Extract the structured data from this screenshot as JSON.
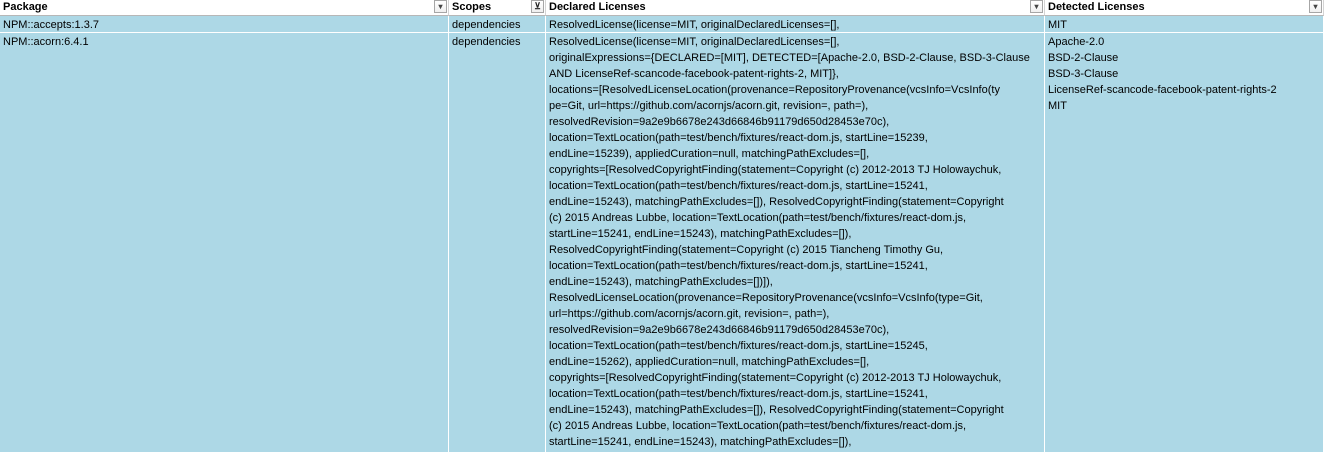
{
  "headers": {
    "package": "Package",
    "scopes": "Scopes",
    "declared": "Declared Licenses",
    "detected": "Detected Licenses"
  },
  "rows": [
    {
      "package": "NPM::accepts:1.3.7",
      "scopes": "dependencies",
      "declared": "ResolvedLicense(license=MIT, originalDeclaredLicenses=[],",
      "detected": "MIT"
    },
    {
      "package": "NPM::acorn:6.4.1",
      "scopes": "dependencies",
      "declared": "ResolvedLicense(license=MIT, originalDeclaredLicenses=[],\noriginalExpressions={DECLARED=[MIT], DETECTED=[Apache-2.0, BSD-2-Clause, BSD-3-Clause\nAND LicenseRef-scancode-facebook-patent-rights-2, MIT]},\nlocations=[ResolvedLicenseLocation(provenance=RepositoryProvenance(vcsInfo=VcsInfo(ty\npe=Git, url=https://github.com/acornjs/acorn.git, revision=, path=),\nresolvedRevision=9a2e9b6678e243d66846b91179d650d28453e70c),\nlocation=TextLocation(path=test/bench/fixtures/react-dom.js, startLine=15239,\nendLine=15239), appliedCuration=null, matchingPathExcludes=[],\ncopyrights=[ResolvedCopyrightFinding(statement=Copyright (c) 2012-2013 TJ Holowaychuk,\nlocation=TextLocation(path=test/bench/fixtures/react-dom.js, startLine=15241,\nendLine=15243), matchingPathExcludes=[]), ResolvedCopyrightFinding(statement=Copyright\n(c) 2015 Andreas Lubbe, location=TextLocation(path=test/bench/fixtures/react-dom.js,\nstartLine=15241, endLine=15243), matchingPathExcludes=[]),\nResolvedCopyrightFinding(statement=Copyright (c) 2015 Tiancheng Timothy Gu,\nlocation=TextLocation(path=test/bench/fixtures/react-dom.js, startLine=15241,\nendLine=15243), matchingPathExcludes=[])]),\nResolvedLicenseLocation(provenance=RepositoryProvenance(vcsInfo=VcsInfo(type=Git,\nurl=https://github.com/acornjs/acorn.git, revision=, path=),\nresolvedRevision=9a2e9b6678e243d66846b91179d650d28453e70c),\nlocation=TextLocation(path=test/bench/fixtures/react-dom.js, startLine=15245,\nendLine=15262), appliedCuration=null, matchingPathExcludes=[],\ncopyrights=[ResolvedCopyrightFinding(statement=Copyright (c) 2012-2013 TJ Holowaychuk,\nlocation=TextLocation(path=test/bench/fixtures/react-dom.js, startLine=15241,\nendLine=15243), matchingPathExcludes=[]), ResolvedCopyrightFinding(statement=Copyright\n(c) 2015 Andreas Lubbe, location=TextLocation(path=test/bench/fixtures/react-dom.js,\nstartLine=15241, endLine=15243), matchingPathExcludes=[]),",
      "detected": "Apache-2.0\nBSD-2-Clause\nBSD-3-Clause\nLicenseRef-scancode-facebook-patent-rights-2\nMIT"
    }
  ],
  "icons": {
    "filter": "dropdown-arrow-icon",
    "filter_active": "filter-active-icon"
  },
  "colors": {
    "row_fill": "#add8e6",
    "header_fill": "#ffffff"
  }
}
